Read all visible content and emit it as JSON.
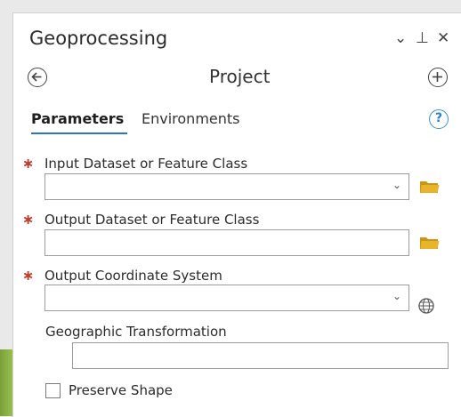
{
  "panel": {
    "title": "Geoprocessing",
    "controls": {
      "dropdown": "⌄",
      "pin": "⊥",
      "close": "✕"
    }
  },
  "tool": {
    "name": "Project"
  },
  "tabs": [
    {
      "label": "Parameters",
      "active": true
    },
    {
      "label": "Environments",
      "active": false
    }
  ],
  "help": {
    "glyph": "?"
  },
  "parameters": {
    "input_dataset": {
      "label": "Input Dataset or Feature Class",
      "required": true,
      "value": "",
      "icon": "folder-icon"
    },
    "output_dataset": {
      "label": "Output Dataset or Feature Class",
      "required": true,
      "value": "",
      "icon": "folder-icon"
    },
    "output_coordinate_system": {
      "label": "Output Coordinate System",
      "required": true,
      "value": "",
      "icon": "globe-icon"
    },
    "geographic_transformation": {
      "label": "Geographic Transformation",
      "required": false,
      "value": ""
    },
    "preserve_shape": {
      "label": "Preserve Shape",
      "checked": false
    }
  },
  "required_marker": "∗",
  "colors": {
    "accent": "#2a76c6",
    "required": "#c0392b",
    "folder": "#e8b429",
    "background": "#e9e9e9"
  }
}
